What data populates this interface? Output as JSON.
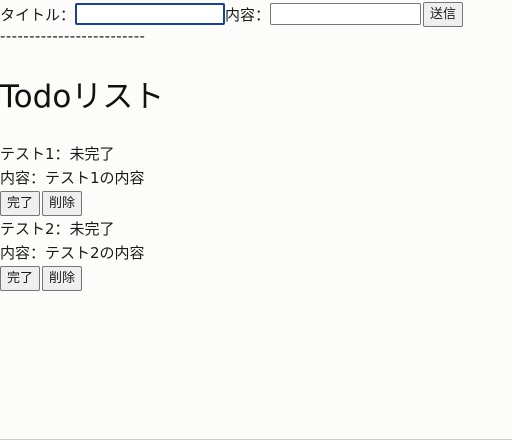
{
  "form": {
    "title_label": "タイトル：",
    "title_value": "",
    "content_label": "内容：",
    "content_value": "",
    "submit_label": "送信"
  },
  "divider_text": "-------------------------",
  "heading": "Todoリスト",
  "todos": [
    {
      "status_line": "テスト1：未完了",
      "content_line": "内容：テスト1の内容",
      "complete_label": "完了",
      "delete_label": "削除"
    },
    {
      "status_line": "テスト2：未完了",
      "content_line": "内容：テスト2の内容",
      "complete_label": "完了",
      "delete_label": "削除"
    }
  ]
}
